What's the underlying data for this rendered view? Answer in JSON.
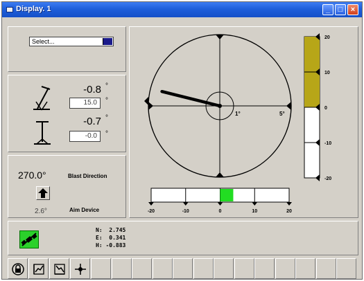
{
  "window": {
    "title": "Display. 1"
  },
  "titlebar_buttons": {
    "minimize": "_",
    "maximize": "□",
    "close": "×"
  },
  "select": {
    "value": "Select..."
  },
  "angles": {
    "pitch": {
      "value": "-0.8",
      "unit": "°",
      "setpoint": "15.0",
      "setpoint_unit": "°"
    },
    "roll": {
      "value": "-0.7",
      "unit": "°",
      "setpoint": "-0.0",
      "setpoint_unit": "°"
    }
  },
  "blast": {
    "direction_value": "270.0°",
    "direction_label": "Blast Direction",
    "aim_value": "2.6°",
    "aim_label": "Aim Device"
  },
  "dial": {
    "inner_label": "1°",
    "outer_label": "5°",
    "needle_heading_deg": 284
  },
  "vertical_scale": {
    "ticks": [
      "20",
      "10",
      "0",
      "-10",
      "-20"
    ],
    "fill_from": 0,
    "fill_to": 20,
    "fill_color": "#b7a618"
  },
  "horizontal_scale": {
    "ticks": [
      "-20",
      "-10",
      "0",
      "10",
      "20"
    ],
    "indicator_value": 2,
    "indicator_color": "#22dd22"
  },
  "status": {
    "n": "N:  2.745",
    "e": "E:  0.341",
    "h": "H: -0.883"
  },
  "toolbar": {
    "buttons": [
      "lock-icon",
      "chart-up-icon",
      "chart-down-icon",
      "crosshair-icon"
    ],
    "empty_slots": 13
  },
  "colors": {
    "title_bar": "#1f5fdb",
    "panel_bg": "#d4d0c8",
    "gps_green": "#2bd02b"
  }
}
